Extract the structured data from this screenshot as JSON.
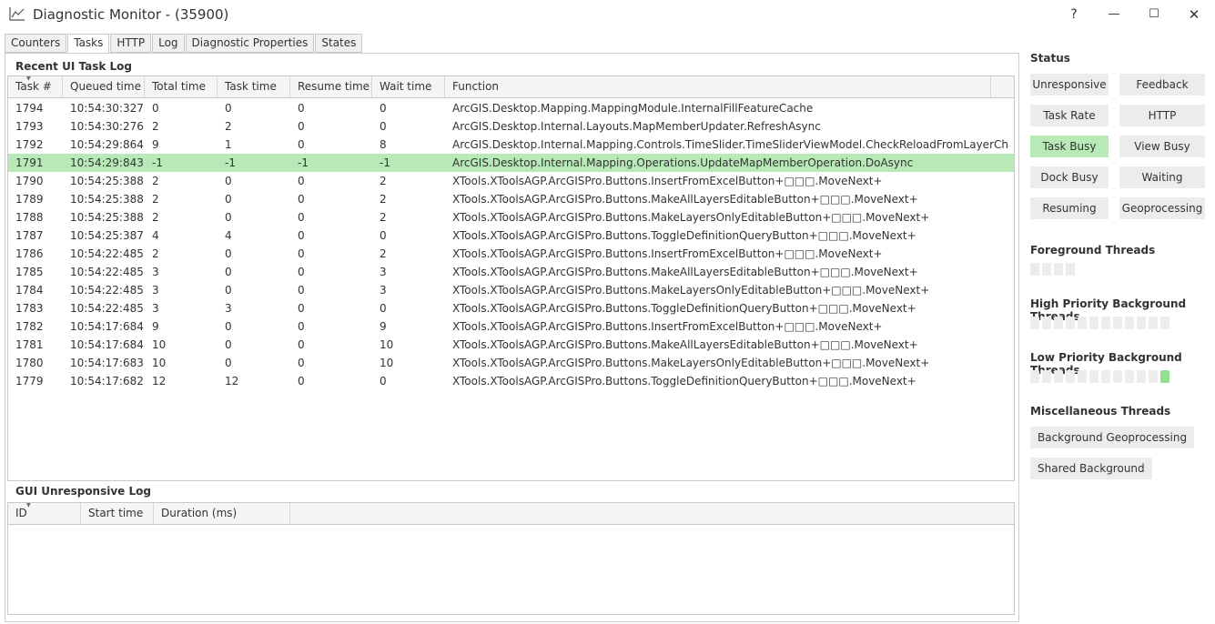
{
  "window": {
    "title": "Diagnostic Monitor - (35900)",
    "help": "?",
    "minimize": "—",
    "maximize": "☐",
    "close": "✕"
  },
  "tabs": [
    {
      "label": "Counters",
      "active": false
    },
    {
      "label": "Tasks",
      "active": true
    },
    {
      "label": "HTTP",
      "active": false
    },
    {
      "label": "Log",
      "active": false
    },
    {
      "label": "Diagnostic Properties",
      "active": false
    },
    {
      "label": "States",
      "active": false
    }
  ],
  "task_log": {
    "title": "Recent UI Task Log",
    "columns": [
      "Task #",
      "Queued time",
      "Total time",
      "Task time",
      "Resume time",
      "Wait time",
      "Function"
    ],
    "rows": [
      [
        "1794",
        "10:54:30:327",
        "0",
        "0",
        "0",
        "0",
        "ArcGIS.Desktop.Mapping.MappingModule.InternalFillFeatureCache"
      ],
      [
        "1793",
        "10:54:30:276",
        "2",
        "2",
        "0",
        "0",
        "ArcGIS.Desktop.Internal.Layouts.MapMemberUpdater.RefreshAsync"
      ],
      [
        "1792",
        "10:54:29:864",
        "9",
        "1",
        "0",
        "8",
        "ArcGIS.Desktop.Internal.Mapping.Controls.TimeSlider.TimeSliderViewModel.CheckReloadFromLayerChanges+"
      ],
      [
        "1791",
        "10:54:29:843",
        "-1",
        "-1",
        "-1",
        "-1",
        "ArcGIS.Desktop.Internal.Mapping.Operations.UpdateMapMemberOperation.DoAsync"
      ],
      [
        "1790",
        "10:54:25:388",
        "2",
        "0",
        "0",
        "2",
        "XTools.XToolsAGP.ArcGISPro.Buttons.InsertFromExcelButton+□□□.MoveNext+"
      ],
      [
        "1789",
        "10:54:25:388",
        "2",
        "0",
        "0",
        "2",
        "XTools.XToolsAGP.ArcGISPro.Buttons.MakeAllLayersEditableButton+□□□.MoveNext+"
      ],
      [
        "1788",
        "10:54:25:388",
        "2",
        "0",
        "0",
        "2",
        "XTools.XToolsAGP.ArcGISPro.Buttons.MakeLayersOnlyEditableButton+□□□.MoveNext+"
      ],
      [
        "1787",
        "10:54:25:387",
        "4",
        "4",
        "0",
        "0",
        "XTools.XToolsAGP.ArcGISPro.Buttons.ToggleDefinitionQueryButton+□□□.MoveNext+"
      ],
      [
        "1786",
        "10:54:22:485",
        "2",
        "0",
        "0",
        "2",
        "XTools.XToolsAGP.ArcGISPro.Buttons.InsertFromExcelButton+□□□.MoveNext+"
      ],
      [
        "1785",
        "10:54:22:485",
        "3",
        "0",
        "0",
        "3",
        "XTools.XToolsAGP.ArcGISPro.Buttons.MakeAllLayersEditableButton+□□□.MoveNext+"
      ],
      [
        "1784",
        "10:54:22:485",
        "3",
        "0",
        "0",
        "3",
        "XTools.XToolsAGP.ArcGISPro.Buttons.MakeLayersOnlyEditableButton+□□□.MoveNext+"
      ],
      [
        "1783",
        "10:54:22:485",
        "3",
        "3",
        "0",
        "0",
        "XTools.XToolsAGP.ArcGISPro.Buttons.ToggleDefinitionQueryButton+□□□.MoveNext+"
      ],
      [
        "1782",
        "10:54:17:684",
        "9",
        "0",
        "0",
        "9",
        "XTools.XToolsAGP.ArcGISPro.Buttons.InsertFromExcelButton+□□□.MoveNext+"
      ],
      [
        "1781",
        "10:54:17:684",
        "10",
        "0",
        "0",
        "10",
        "XTools.XToolsAGP.ArcGISPro.Buttons.MakeAllLayersEditableButton+□□□.MoveNext+"
      ],
      [
        "1780",
        "10:54:17:683",
        "10",
        "0",
        "0",
        "10",
        "XTools.XToolsAGP.ArcGISPro.Buttons.MakeLayersOnlyEditableButton+□□□.MoveNext+"
      ],
      [
        "1779",
        "10:54:17:682",
        "12",
        "12",
        "0",
        "0",
        "XTools.XToolsAGP.ArcGISPro.Buttons.ToggleDefinitionQueryButton+□□□.MoveNext+"
      ]
    ],
    "selected_task": "1791"
  },
  "unresponsive_log": {
    "title": "GUI Unresponsive Log",
    "columns": [
      "ID",
      "Start time",
      "Duration (ms)"
    ]
  },
  "status": {
    "title": "Status",
    "buttons": [
      {
        "label": "Unresponsive",
        "active": false
      },
      {
        "label": "Feedback",
        "active": false
      },
      {
        "label": "Task Rate",
        "active": false
      },
      {
        "label": "HTTP",
        "active": false
      },
      {
        "label": "Task Busy",
        "active": true
      },
      {
        "label": "View Busy",
        "active": false
      },
      {
        "label": "Dock Busy",
        "active": false
      },
      {
        "label": "Waiting",
        "active": false
      },
      {
        "label": "Resuming",
        "active": false
      },
      {
        "label": "Geoprocessing",
        "active": false
      }
    ]
  },
  "threads": {
    "foreground": {
      "title": "Foreground Threads",
      "count": 4,
      "active_index": -1
    },
    "high_priority": {
      "title": "High Priority Background Threads",
      "count": 12,
      "active_index": -1
    },
    "low_priority": {
      "title": "Low Priority Background Threads",
      "count": 12,
      "active_index": 11
    },
    "misc": {
      "title": "Miscellaneous Threads",
      "items": [
        "Background Geoprocessing",
        "Shared Background"
      ]
    }
  },
  "colors": {
    "selected_row": "#b8eab8",
    "active_status": "#b8eab8",
    "active_thread": "#90e090"
  }
}
